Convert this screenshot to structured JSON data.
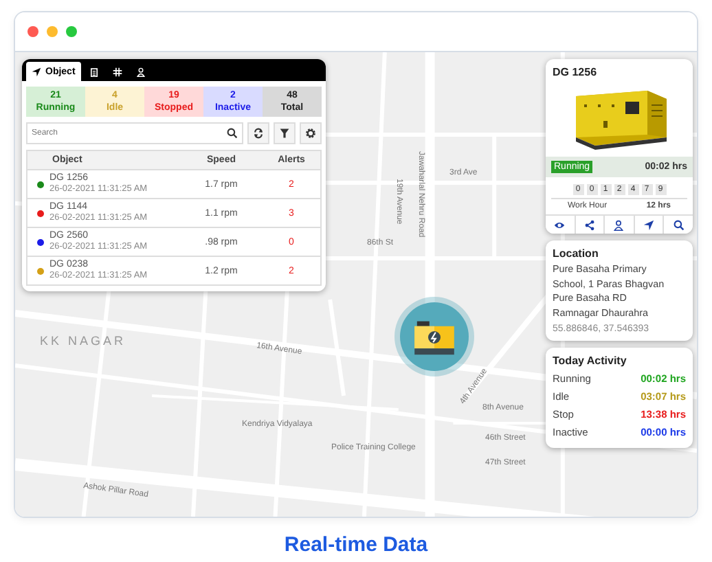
{
  "map": {
    "labels": [
      "KK NAGAR",
      "16th Avenue",
      "Ashok Pillar Road",
      "Kendriya Vidyalaya",
      "Police Training College",
      "8th Avenue",
      "46th Street",
      "47th Street",
      "4th Avenue",
      "3rd Ave",
      "Jawaharlal Nehru Road",
      "19th Avenue",
      "86th St"
    ]
  },
  "object_panel": {
    "tabs": [
      {
        "kind": "object",
        "label": "Object",
        "selected": true
      },
      {
        "kind": "clipboard",
        "selected": false
      },
      {
        "kind": "grid",
        "selected": false
      },
      {
        "kind": "person",
        "selected": false
      }
    ],
    "stats": [
      {
        "kind": "running",
        "count": "21",
        "label": "Running"
      },
      {
        "kind": "idle",
        "count": "4",
        "label": "Idle"
      },
      {
        "kind": "stopped",
        "count": "19",
        "label": "Stopped"
      },
      {
        "kind": "inactive",
        "count": "2",
        "label": "Inactive"
      },
      {
        "kind": "total",
        "count": "48",
        "label": "Total"
      }
    ],
    "search": {
      "placeholder": "Search"
    },
    "table": {
      "columns": [
        "Object",
        "Speed",
        "Alerts"
      ],
      "rows": [
        {
          "name": "DG 1256",
          "time": "26-02-2021 11:31:25 AM",
          "speed": "1.7 rpm",
          "alerts": "2",
          "color": "#1a8a1a"
        },
        {
          "name": "DG 1144",
          "time": "26-02-2021 11:31:25 AM",
          "speed": "1.1 rpm",
          "alerts": "3",
          "color": "#e81c1c"
        },
        {
          "name": "DG 2560",
          "time": "26-02-2021 11:31:25 AM",
          "speed": ".98 rpm",
          "alerts": "0",
          "color": "#1c1ce8"
        },
        {
          "name": "DG 0238",
          "time": "26-02-2021 11:31:25 AM",
          "speed": "1.2 rpm",
          "alerts": "2",
          "color": "#d4a017"
        }
      ]
    }
  },
  "detail_card": {
    "title": "DG 1256",
    "status": {
      "kind": "running",
      "label": "Running"
    },
    "duration": "00:02 hrs",
    "counter": [
      "0",
      "0",
      "1",
      "2",
      "4",
      "7",
      "9"
    ],
    "work_hour_label": "Work Hour",
    "work_hour_value": "12 hrs"
  },
  "location": {
    "title": "Location",
    "address": [
      "Pure Basaha Primary",
      "School, 1 Paras Bhagvan",
      "Pure Basaha RD",
      "Ramnagar Dhaurahra"
    ],
    "coordinates": "55.886846, 37.546393"
  },
  "today_activity": {
    "title": "Today Activity",
    "rows": [
      {
        "label": "Running",
        "value": "00:02 hrs",
        "color": "#1fa51f"
      },
      {
        "label": "Idle",
        "value": "03:07 hrs",
        "color": "#b59a1a"
      },
      {
        "label": "Stop",
        "value": "13:38 hrs",
        "color": "#e81c1c"
      },
      {
        "label": "Inactive",
        "value": "00:00 hrs",
        "color": "#1c3ae8"
      }
    ]
  },
  "caption": "Real-time Data"
}
